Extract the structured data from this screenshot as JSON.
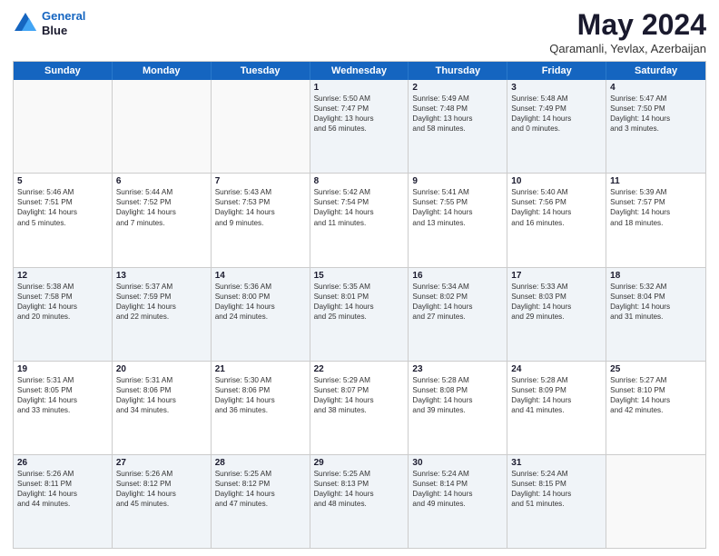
{
  "logo": {
    "line1": "General",
    "line2": "Blue"
  },
  "title": {
    "main": "May 2024",
    "sub": "Qaramanli, Yevlax, Azerbaijan"
  },
  "headers": [
    "Sunday",
    "Monday",
    "Tuesday",
    "Wednesday",
    "Thursday",
    "Friday",
    "Saturday"
  ],
  "weeks": [
    [
      {
        "day": "",
        "info": ""
      },
      {
        "day": "",
        "info": ""
      },
      {
        "day": "",
        "info": ""
      },
      {
        "day": "1",
        "info": "Sunrise: 5:50 AM\nSunset: 7:47 PM\nDaylight: 13 hours\nand 56 minutes."
      },
      {
        "day": "2",
        "info": "Sunrise: 5:49 AM\nSunset: 7:48 PM\nDaylight: 13 hours\nand 58 minutes."
      },
      {
        "day": "3",
        "info": "Sunrise: 5:48 AM\nSunset: 7:49 PM\nDaylight: 14 hours\nand 0 minutes."
      },
      {
        "day": "4",
        "info": "Sunrise: 5:47 AM\nSunset: 7:50 PM\nDaylight: 14 hours\nand 3 minutes."
      }
    ],
    [
      {
        "day": "5",
        "info": "Sunrise: 5:46 AM\nSunset: 7:51 PM\nDaylight: 14 hours\nand 5 minutes."
      },
      {
        "day": "6",
        "info": "Sunrise: 5:44 AM\nSunset: 7:52 PM\nDaylight: 14 hours\nand 7 minutes."
      },
      {
        "day": "7",
        "info": "Sunrise: 5:43 AM\nSunset: 7:53 PM\nDaylight: 14 hours\nand 9 minutes."
      },
      {
        "day": "8",
        "info": "Sunrise: 5:42 AM\nSunset: 7:54 PM\nDaylight: 14 hours\nand 11 minutes."
      },
      {
        "day": "9",
        "info": "Sunrise: 5:41 AM\nSunset: 7:55 PM\nDaylight: 14 hours\nand 13 minutes."
      },
      {
        "day": "10",
        "info": "Sunrise: 5:40 AM\nSunset: 7:56 PM\nDaylight: 14 hours\nand 16 minutes."
      },
      {
        "day": "11",
        "info": "Sunrise: 5:39 AM\nSunset: 7:57 PM\nDaylight: 14 hours\nand 18 minutes."
      }
    ],
    [
      {
        "day": "12",
        "info": "Sunrise: 5:38 AM\nSunset: 7:58 PM\nDaylight: 14 hours\nand 20 minutes."
      },
      {
        "day": "13",
        "info": "Sunrise: 5:37 AM\nSunset: 7:59 PM\nDaylight: 14 hours\nand 22 minutes."
      },
      {
        "day": "14",
        "info": "Sunrise: 5:36 AM\nSunset: 8:00 PM\nDaylight: 14 hours\nand 24 minutes."
      },
      {
        "day": "15",
        "info": "Sunrise: 5:35 AM\nSunset: 8:01 PM\nDaylight: 14 hours\nand 25 minutes."
      },
      {
        "day": "16",
        "info": "Sunrise: 5:34 AM\nSunset: 8:02 PM\nDaylight: 14 hours\nand 27 minutes."
      },
      {
        "day": "17",
        "info": "Sunrise: 5:33 AM\nSunset: 8:03 PM\nDaylight: 14 hours\nand 29 minutes."
      },
      {
        "day": "18",
        "info": "Sunrise: 5:32 AM\nSunset: 8:04 PM\nDaylight: 14 hours\nand 31 minutes."
      }
    ],
    [
      {
        "day": "19",
        "info": "Sunrise: 5:31 AM\nSunset: 8:05 PM\nDaylight: 14 hours\nand 33 minutes."
      },
      {
        "day": "20",
        "info": "Sunrise: 5:31 AM\nSunset: 8:06 PM\nDaylight: 14 hours\nand 34 minutes."
      },
      {
        "day": "21",
        "info": "Sunrise: 5:30 AM\nSunset: 8:06 PM\nDaylight: 14 hours\nand 36 minutes."
      },
      {
        "day": "22",
        "info": "Sunrise: 5:29 AM\nSunset: 8:07 PM\nDaylight: 14 hours\nand 38 minutes."
      },
      {
        "day": "23",
        "info": "Sunrise: 5:28 AM\nSunset: 8:08 PM\nDaylight: 14 hours\nand 39 minutes."
      },
      {
        "day": "24",
        "info": "Sunrise: 5:28 AM\nSunset: 8:09 PM\nDaylight: 14 hours\nand 41 minutes."
      },
      {
        "day": "25",
        "info": "Sunrise: 5:27 AM\nSunset: 8:10 PM\nDaylight: 14 hours\nand 42 minutes."
      }
    ],
    [
      {
        "day": "26",
        "info": "Sunrise: 5:26 AM\nSunset: 8:11 PM\nDaylight: 14 hours\nand 44 minutes."
      },
      {
        "day": "27",
        "info": "Sunrise: 5:26 AM\nSunset: 8:12 PM\nDaylight: 14 hours\nand 45 minutes."
      },
      {
        "day": "28",
        "info": "Sunrise: 5:25 AM\nSunset: 8:12 PM\nDaylight: 14 hours\nand 47 minutes."
      },
      {
        "day": "29",
        "info": "Sunrise: 5:25 AM\nSunset: 8:13 PM\nDaylight: 14 hours\nand 48 minutes."
      },
      {
        "day": "30",
        "info": "Sunrise: 5:24 AM\nSunset: 8:14 PM\nDaylight: 14 hours\nand 49 minutes."
      },
      {
        "day": "31",
        "info": "Sunrise: 5:24 AM\nSunset: 8:15 PM\nDaylight: 14 hours\nand 51 minutes."
      },
      {
        "day": "",
        "info": ""
      }
    ]
  ]
}
